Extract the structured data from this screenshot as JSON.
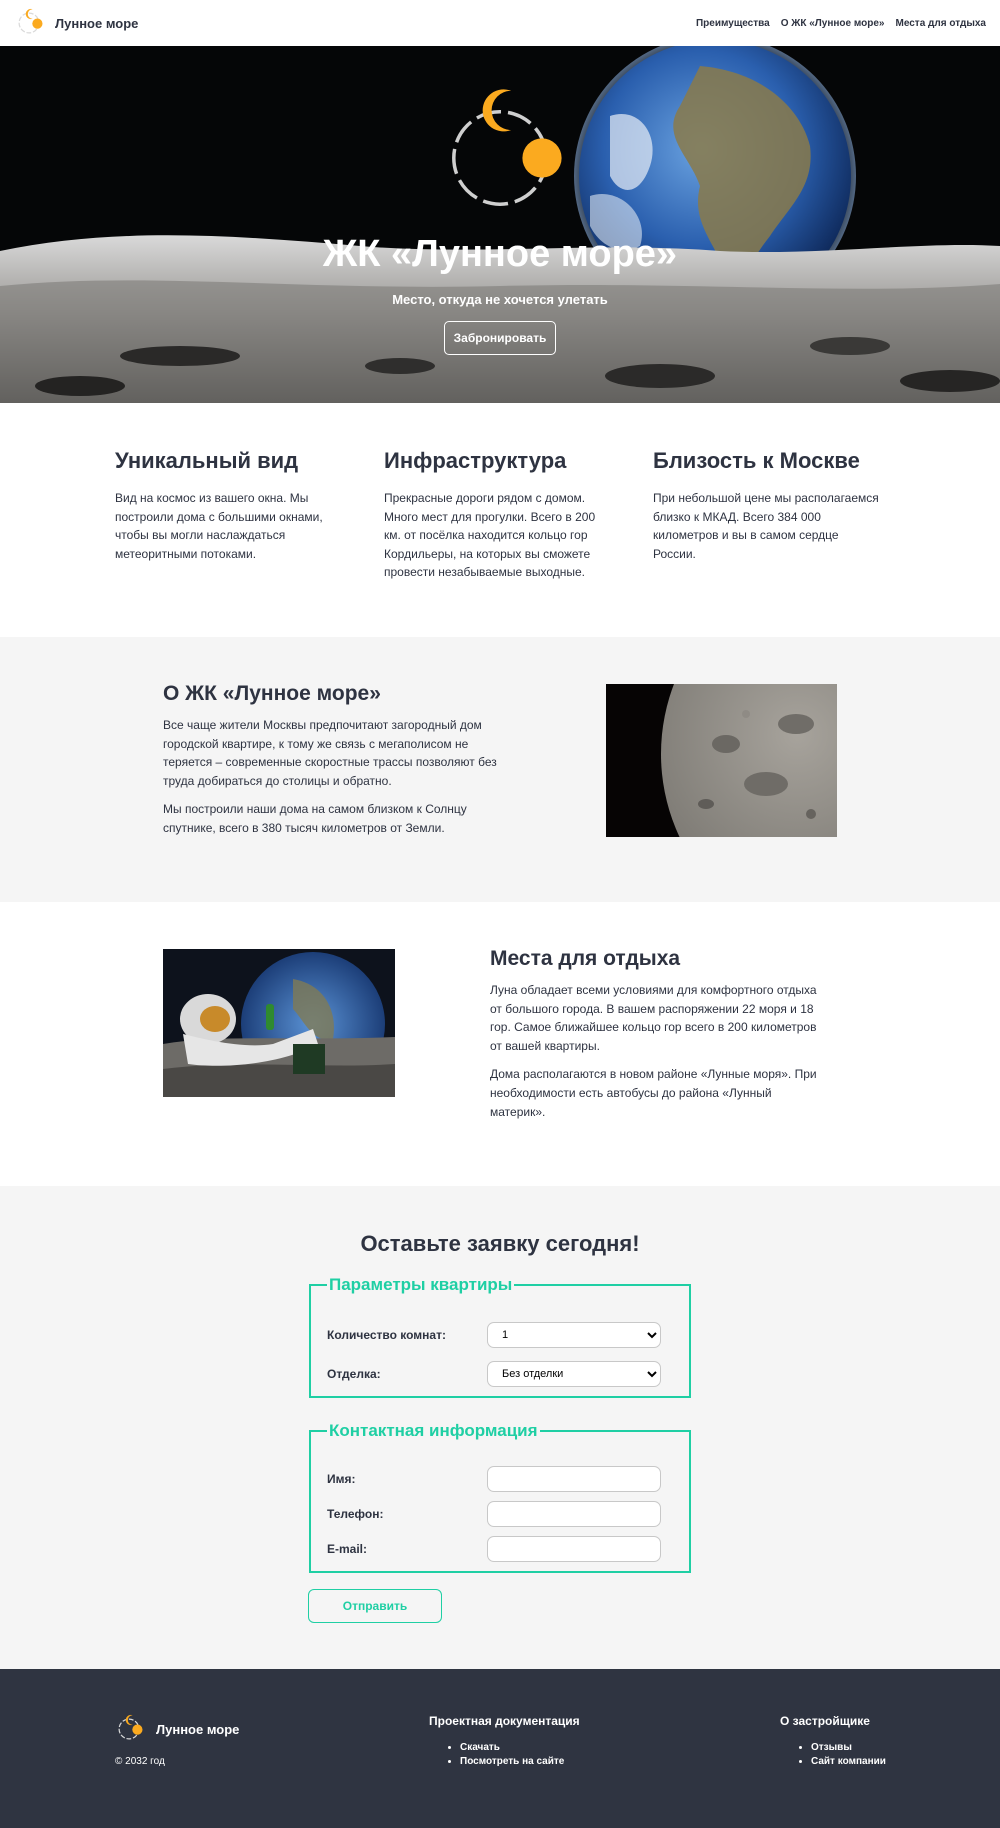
{
  "header": {
    "brand": "Лунное море",
    "nav": [
      "Преимущества",
      "О ЖК «Лунное море»",
      "Места для отдыха"
    ]
  },
  "hero": {
    "title": "ЖК «Лунное море»",
    "subtitle": "Место, откуда не хочется улетать",
    "button": "Забронировать"
  },
  "features": [
    {
      "title": "Уникальный вид",
      "text": "Вид на космос из вашего окна. Мы построили дома с большими окнами, чтобы вы могли наслаждаться метеоритными потоками."
    },
    {
      "title": "Инфраструктура",
      "text": "Прекрасные дороги рядом с домом. Много мест для прогулки. Всего в 200 км. от посёлка находится кольцо гор Кордильеры, на которых вы сможете провести незабываемые выходные."
    },
    {
      "title": "Близость к Москве",
      "text": "При небольшой цене мы располагаемся близко к МКАД. Всего 384 000 километров и вы в самом сердце России."
    }
  ],
  "about": {
    "title": "О ЖК «Лунное море»",
    "p1": "Все чаще жители Москвы предпочитают загородный дом городской квартире, к тому же связь с мегаполисом не теряется – современные скоростные трассы позволяют без труда добираться до столицы и обратно.",
    "p2": "Мы построили наши дома на самом близком к Солнцу спутнике, всего в 380 тысяч километров от Земли."
  },
  "rest": {
    "title": "Места для отдыха",
    "p1": "Луна обладает всеми условиями для комфортного отдыха от большого города. В вашем распоряжении 22 моря и 18 гор. Самое ближайшее кольцо гор всего в 200 километров от вашей квартиры.",
    "p2": "Дома располагаются в новом районе «Лунные моря». При необходимости есть автобусы до района «Лунный материк»."
  },
  "form": {
    "title": "Оставьте заявку сегодня!",
    "apartment_legend": "Параметры квартиры",
    "rooms_label": "Количество комнат:",
    "rooms_value": "1",
    "finish_label": "Отделка:",
    "finish_value": "Без отделки",
    "contact_legend": "Контактная информация",
    "name_label": "Имя:",
    "phone_label": "Телефон:",
    "email_label": "E-mail:",
    "submit": "Отправить"
  },
  "footer": {
    "brand": "Лунное море",
    "copyright": "© 2032 год",
    "docs_title": "Проектная документация",
    "docs_links": [
      "Скачать",
      "Посмотреть на сайте"
    ],
    "dev_title": "О застройщике",
    "dev_links": [
      "Отзывы",
      "Сайт компании"
    ]
  },
  "colors": {
    "accent": "#1fcfa4",
    "logo": "#fbaa1f",
    "text": "#2e3341",
    "footer": "#2f3441"
  }
}
